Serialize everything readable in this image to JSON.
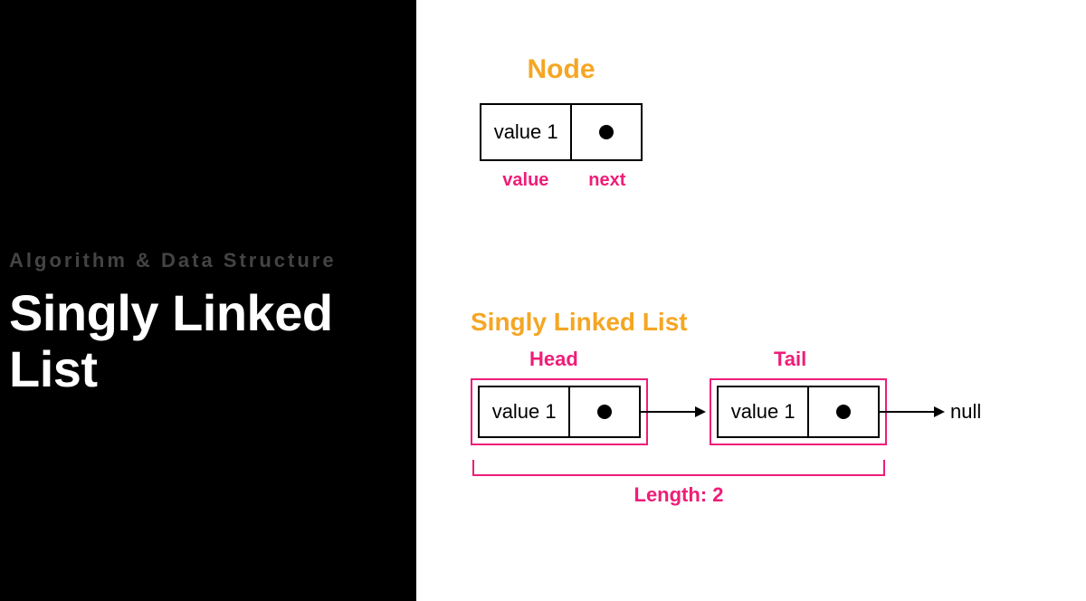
{
  "left": {
    "super": "Algorithm & Data Structure",
    "title_line1": "Singly Linked",
    "title_line2": "List"
  },
  "node": {
    "heading": "Node",
    "value": "value 1",
    "value_label": "value",
    "next_label": "next"
  },
  "sll": {
    "heading": "Singly Linked List",
    "head_label": "Head",
    "tail_label": "Tail",
    "node1_value": "value 1",
    "node2_value": "value 1",
    "null_label": "null",
    "length_label": "Length: 2"
  },
  "colors": {
    "orange": "#f5a623",
    "pink": "#ef1d78"
  }
}
